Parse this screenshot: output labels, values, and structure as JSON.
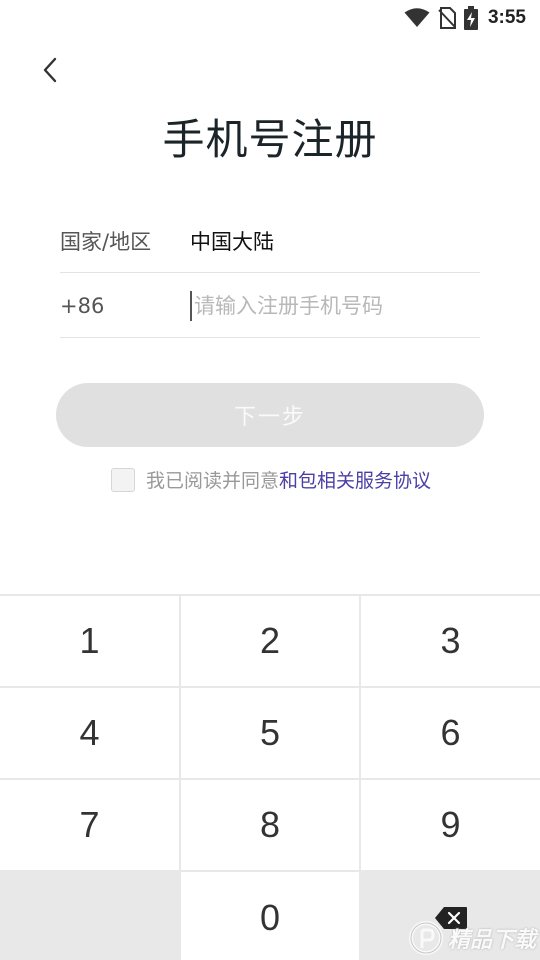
{
  "status_bar": {
    "time": "3:55",
    "icons": [
      "wifi-icon",
      "no-sim-icon",
      "battery-charging-icon"
    ]
  },
  "header": {
    "back_icon": "chevron-left-icon",
    "title": "手机号注册"
  },
  "form": {
    "country_label": "国家/地区",
    "country_value": "中国大陆",
    "country_code": "+86",
    "phone_placeholder": "请输入注册手机号码",
    "phone_value": ""
  },
  "next_button": {
    "label": "下一步"
  },
  "agreement": {
    "checked": false,
    "text": "我已阅读并同意",
    "link_text": "和包相关服务协议",
    "link_color": "#4b3fa6"
  },
  "keypad": {
    "keys": [
      "1",
      "2",
      "3",
      "4",
      "5",
      "6",
      "7",
      "8",
      "9",
      "",
      "0",
      "backspace"
    ],
    "backspace_icon": "backspace-icon"
  },
  "watermark": {
    "text": "精品下载"
  }
}
